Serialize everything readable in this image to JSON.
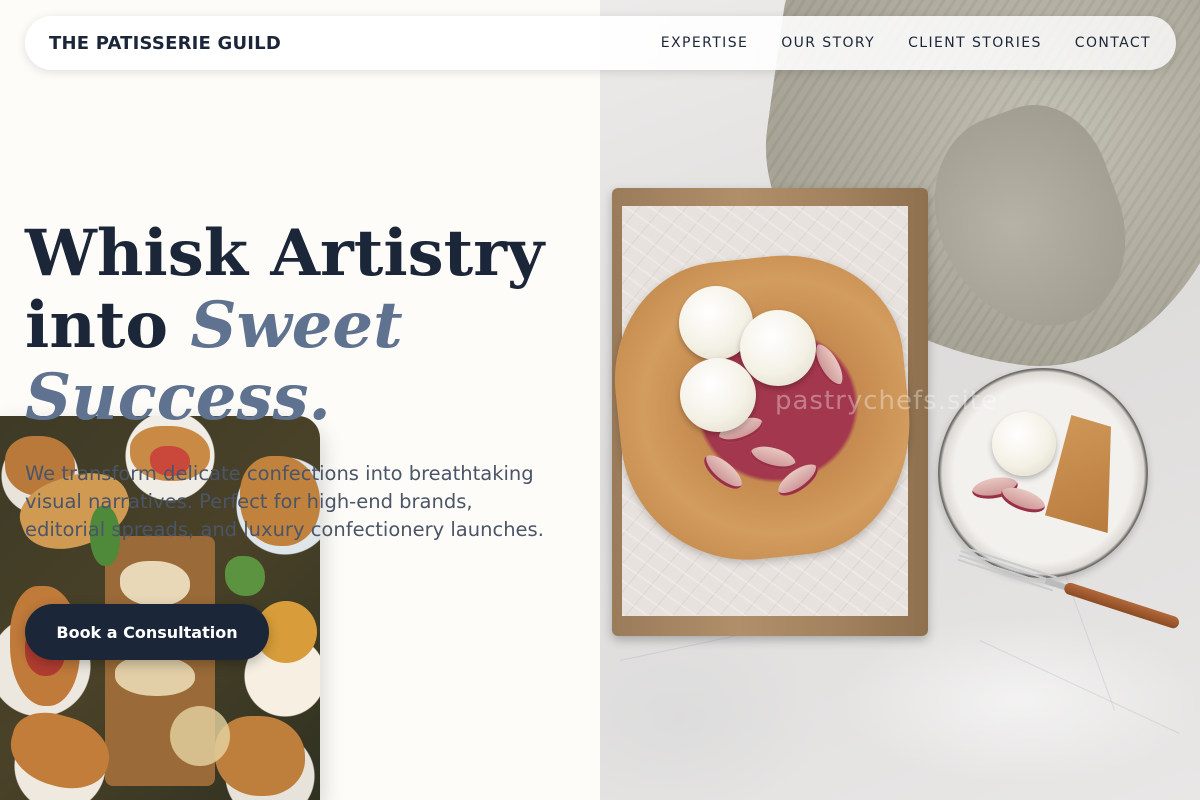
{
  "brand": {
    "name": "THE PATISSERIE GUILD"
  },
  "nav": {
    "links": [
      "EXPERTISE",
      "OUR STORY",
      "CLIENT STORIES",
      "CONTACT"
    ]
  },
  "hero": {
    "title_line1": "Whisk Artistry",
    "title_line2_plain": "into ",
    "title_line2_accent": "Sweet",
    "title_line3_accent": "Success.",
    "subtitle": "We transform delicate confections into breathtaking visual narratives. Perfect for high-end brands, editorial spreads, and luxury confectionery launches.",
    "cta_label": "Book a Consultation"
  },
  "images": {
    "right_panel_watermark": "pastrychefs.site"
  },
  "colors": {
    "navy": "#1c2639",
    "accent_slate": "#5f7290",
    "page_background": "#fdfcf8",
    "body_text": "#4b5568"
  },
  "icons": {
    "logo": "wordmark"
  }
}
